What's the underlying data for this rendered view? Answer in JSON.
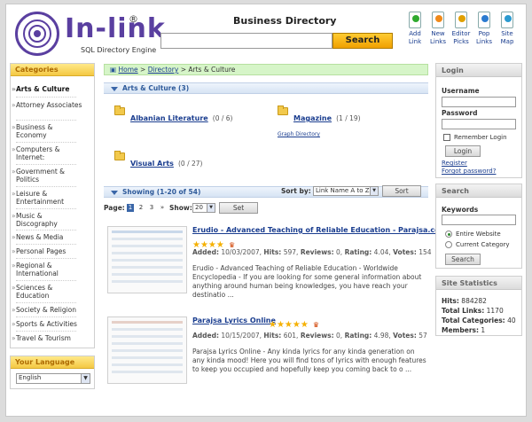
{
  "header": {
    "brand": "In-link",
    "registered": "®",
    "tagline": "SQL Directory Engine",
    "directory_title": "Business Directory",
    "search_button": "Search",
    "icons": [
      {
        "name": "add-link-icon",
        "label1": "Add",
        "label2": "Link",
        "color": "#2faa2f"
      },
      {
        "name": "new-links-icon",
        "label1": "New",
        "label2": "Links",
        "color": "#f08a1a"
      },
      {
        "name": "editor-picks-icon",
        "label1": "Editor",
        "label2": "Picks",
        "color": "#e0a000"
      },
      {
        "name": "pop-links-icon",
        "label1": "Pop",
        "label2": "Links",
        "color": "#2b7bd0"
      },
      {
        "name": "site-map-icon",
        "label1": "Site",
        "label2": "Map",
        "color": "#2b9ad0"
      }
    ]
  },
  "categories": {
    "title": "Categories",
    "items": [
      "Arts & Culture",
      "Attorney Associates",
      "Business & Economy",
      "Computers & Internet:",
      "Government & Politics",
      "Leisure & Entertainment",
      "Music & Discography",
      "News & Media",
      "Personal Pages",
      "Regional & International",
      "Sciences & Education",
      "Society & Religion",
      "Sports & Activities",
      "Travel & Tourism"
    ]
  },
  "language": {
    "title": "Your Language",
    "value": "English"
  },
  "breadcrumb": {
    "home": "Home",
    "sep1": ">",
    "directory": "Directory",
    "sep2": ">",
    "current": "Arts & Culture"
  },
  "category_bar": "Arts & Culture (3)",
  "subcategories": [
    {
      "name": "Albanian Literature",
      "count": "(0 / 6)"
    },
    {
      "name": "Magazine",
      "count": "(1 / 19)"
    },
    {
      "name": "Visual Arts",
      "count": "(0 / 27)"
    }
  ],
  "subcat_extra": "Graph Directory",
  "showing": {
    "label": "Showing (1-20 of 54)",
    "sort_by": "Sort by:",
    "sort_value": "Link Name A to Z",
    "sort_button": "Sort"
  },
  "paging": {
    "label": "Page:",
    "pages": [
      "1",
      "2",
      "3"
    ],
    "next": "»",
    "show_label": "Show:",
    "show_value": "20",
    "set_button": "Set"
  },
  "listings": [
    {
      "title": "Erudio - Advanced Teaching of Reliable Education - Parajsa.com",
      "stars": "★★★★",
      "added": "10/03/2007",
      "hits": "597",
      "reviews": "0",
      "rating": "4.04",
      "votes": "154",
      "description": "Erudio - Advanced Teaching of Reliable Education - Worldwide Encyclopedia - If you are looking for some general information about anything around human being knowledges, you have reach your destinatio ..."
    },
    {
      "title": "Parajsa Lyrics Online",
      "stars": "★★★★★",
      "added": "10/15/2007",
      "hits": "601",
      "reviews": "0",
      "rating": "4.98",
      "votes": "57",
      "description": "Parajsa Lyrics Online - Any kinda lyrics for any kinda generation on any kinda mood! Here you will find tons of lyrics with enough features to keep you occupied and hopefully keep you coming back to o ..."
    }
  ],
  "meta_labels": {
    "added": "Added:",
    "hits": "Hits:",
    "reviews": "Reviews:",
    "rating": "Rating:",
    "votes": "Votes:"
  },
  "login": {
    "title": "Login",
    "username_label": "Username",
    "password_label": "Password",
    "remember_label": "Remember Login",
    "login_button": "Login",
    "register": "Register",
    "forgot": "Forgot password?"
  },
  "search_box": {
    "title": "Search",
    "keywords_label": "Keywords",
    "opt1": "Entire Website",
    "opt2": "Current Category",
    "button": "Search"
  },
  "stats": {
    "title": "Site Statistics",
    "hits_label": "Hits:",
    "hits": "884282",
    "links_label": "Total Links:",
    "links": "1170",
    "cats_label": "Total Categories:",
    "cats": "40",
    "members_label": "Members:",
    "members": "1"
  },
  "colors": {
    "accent": "#5a3fa0",
    "link": "#1a3d8f",
    "highlight": "#f4c843"
  }
}
